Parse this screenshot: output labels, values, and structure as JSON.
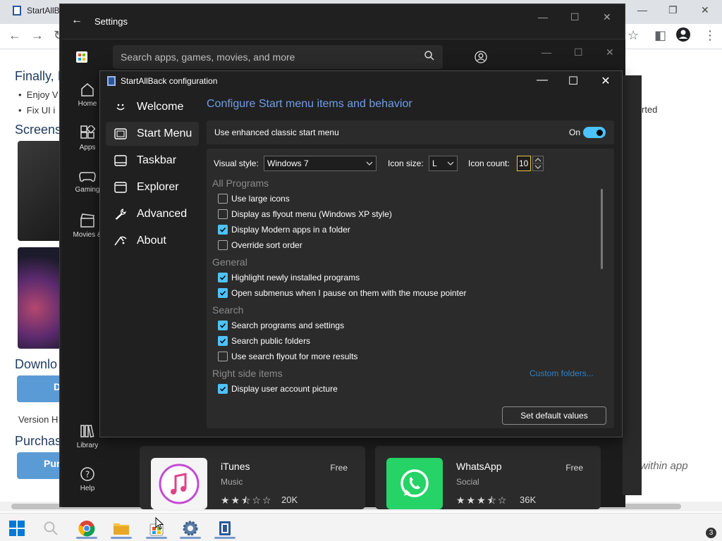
{
  "chrome": {
    "tab_title": "StartAllB",
    "page": {
      "heading1": "Finally, I",
      "bullets": [
        "Enjoy V",
        "Fix UI i"
      ],
      "screenshots_heading": "Screensh",
      "download_heading": "Downlo",
      "download_button": "D",
      "version_text": "Version H",
      "purchase_heading": "Purchase",
      "purchase_button": "Pur",
      "right_text": "rted",
      "within_app_text": "within app"
    }
  },
  "taskbar": {
    "items": [
      "windows-start",
      "search",
      "chrome",
      "file-explorer",
      "microsoft-store",
      "settings",
      "startallback"
    ],
    "notification_count": "3"
  },
  "settings": {
    "title": "Settings"
  },
  "store": {
    "search_placeholder": "Search apps, games, movies, and more",
    "nav": [
      {
        "label": "Home",
        "icon": "home-icon"
      },
      {
        "label": "Apps",
        "icon": "apps-icon"
      },
      {
        "label": "Gaming",
        "icon": "gaming-icon"
      },
      {
        "label": "Movies &",
        "icon": "movies-icon"
      },
      {
        "label": "Library",
        "icon": "library-icon"
      },
      {
        "label": "Help",
        "icon": "help-icon"
      }
    ],
    "cards": [
      {
        "name": "iTunes",
        "category": "Music",
        "price": "Free",
        "rating": 2.5,
        "count": "20K"
      },
      {
        "name": "WhatsApp",
        "category": "Social",
        "price": "Free",
        "rating": 3.5,
        "count": "36K"
      }
    ]
  },
  "sab": {
    "title": "StartAllBack configuration",
    "nav": [
      {
        "label": "Welcome",
        "icon": "smiley-icon"
      },
      {
        "label": "Start Menu",
        "icon": "start-menu-icon"
      },
      {
        "label": "Taskbar",
        "icon": "taskbar-icon"
      },
      {
        "label": "Explorer",
        "icon": "explorer-icon"
      },
      {
        "label": "Advanced",
        "icon": "wrench-icon"
      },
      {
        "label": "About",
        "icon": "about-icon"
      }
    ],
    "heading": "Configure Start menu items and behavior",
    "enhanced": {
      "label": "Use enhanced classic start menu",
      "state": "On"
    },
    "visual_style": {
      "label": "Visual style:",
      "value": "Windows 7"
    },
    "icon_size": {
      "label": "Icon size:",
      "value": "L"
    },
    "icon_count": {
      "label": "Icon count:",
      "value": "10"
    },
    "sections": {
      "all_programs": "All Programs",
      "general": "General",
      "search": "Search",
      "right_side": "Right side items"
    },
    "options": [
      {
        "label": "Use large icons",
        "checked": false
      },
      {
        "label": "Display as flyout menu (Windows XP style)",
        "checked": false
      },
      {
        "label": "Display Modern apps in a folder",
        "checked": true
      },
      {
        "label": "Override sort order",
        "checked": false
      },
      {
        "label": "Highlight newly installed programs",
        "checked": true
      },
      {
        "label": "Open submenus when I pause on them with the mouse pointer",
        "checked": true
      },
      {
        "label": "Search programs and settings",
        "checked": true
      },
      {
        "label": "Search public folders",
        "checked": true
      },
      {
        "label": "Use search flyout for more results",
        "checked": false
      },
      {
        "label": "Display user account picture",
        "checked": true
      }
    ],
    "custom_folders": "Custom folders...",
    "default_button": "Set default values"
  },
  "colors": {
    "accent": "#4cc2ff",
    "heading": "#6e9ee6",
    "link": "#2f81c5"
  }
}
